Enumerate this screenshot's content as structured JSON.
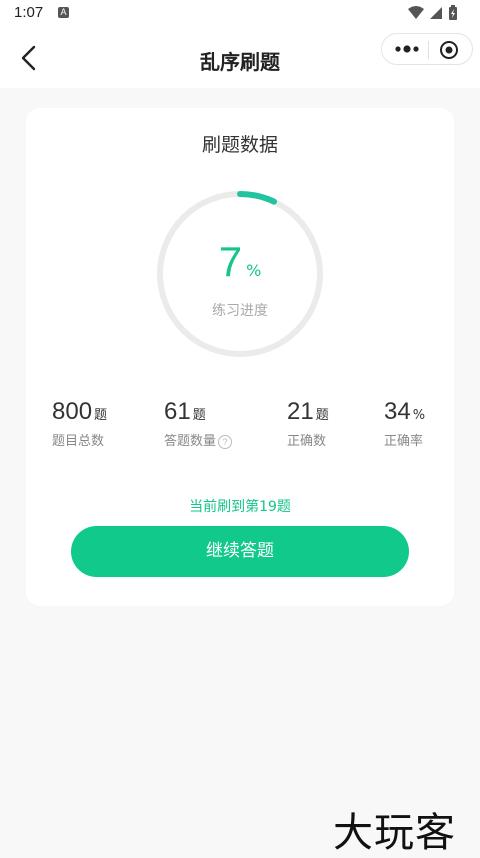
{
  "status": {
    "time": "1:07",
    "badge": "A"
  },
  "nav": {
    "title": "乱序刷题"
  },
  "card": {
    "title": "刷题数据",
    "progress": {
      "value": "7",
      "unit": "%",
      "label": "练习进度",
      "fraction": 0.07
    },
    "stats": [
      {
        "value": "800",
        "unit": "题",
        "label": "题目总数"
      },
      {
        "value": "61",
        "unit": "题",
        "label": "答题数量"
      },
      {
        "value": "21",
        "unit": "题",
        "label": "正确数"
      },
      {
        "value": "34",
        "unit": "%",
        "label": "正确率"
      }
    ],
    "current_text": "当前刷到第19题",
    "button_label": "继续答题"
  },
  "watermark": "大玩客",
  "colors": {
    "accent": "#12c98c",
    "ring_track": "#ebebeb",
    "ring_fill": "#22c4a0"
  }
}
